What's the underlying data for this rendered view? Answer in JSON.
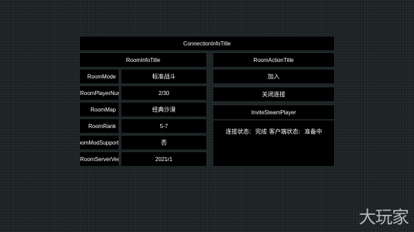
{
  "connection": {
    "title": "ConnectionInfoTitle"
  },
  "room_info": {
    "title": "RoomInfoTitle",
    "rows": [
      {
        "label": "RoomMode",
        "value": "标准战斗"
      },
      {
        "label": "RoomPlayerNumber",
        "value": "2/30"
      },
      {
        "label": "RoomMap",
        "value": "经典沙漠"
      },
      {
        "label": "RoomRank",
        "value": "5-7"
      },
      {
        "label": "RoomModSupport",
        "value": "否"
      },
      {
        "label": "RoomServerVersion",
        "value": "2021r1"
      }
    ]
  },
  "room_action": {
    "title": "RoomActionTitle",
    "join_label": "加入",
    "close_connection_label": "关闭连接",
    "invite_label": "InviteSteamPlayer"
  },
  "status": {
    "connection_label": "连接状态:",
    "connection_value": "完成",
    "client_label": "客户端状态:",
    "client_value": "准备中"
  },
  "watermark": "大玩家"
}
